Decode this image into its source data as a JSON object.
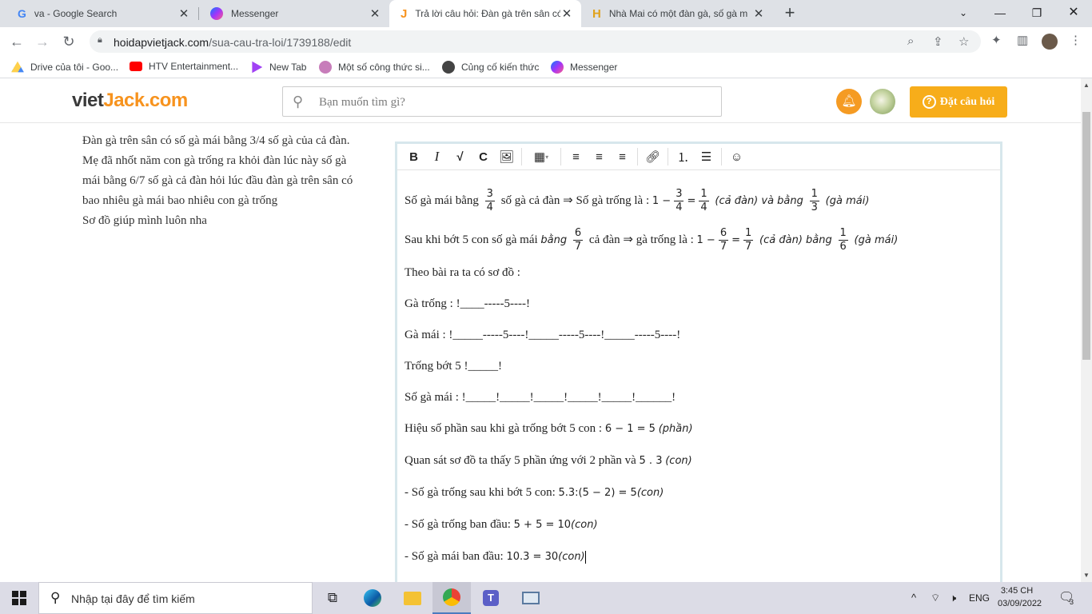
{
  "browser": {
    "tabs": [
      {
        "title": "va - Google Search",
        "icon": "google-icon"
      },
      {
        "title": "Messenger",
        "icon": "messenger-icon"
      },
      {
        "title": "Trả lời câu hỏi: Đàn gà trên sân có",
        "icon": "vietjack-icon"
      },
      {
        "title": "Nhà Mai có một đàn gà, số gà m",
        "icon": "hoidap-icon"
      }
    ],
    "url_domain": "hoidapvietjack.com",
    "url_path": "/sua-cau-tra-loi/1739188/edit",
    "bookmarks": [
      {
        "label": "Drive của tôi - Goo...",
        "icon": "drive-icon",
        "color": "#1fa463"
      },
      {
        "label": "HTV Entertainment...",
        "icon": "youtube-icon",
        "color": "#ff0000"
      },
      {
        "label": "New Tab",
        "icon": "newtab-icon",
        "color": "#a142f4"
      },
      {
        "label": "Một số công thức si...",
        "icon": "app-icon",
        "color": "#c77dba"
      },
      {
        "label": "Củng cố kiến thức",
        "icon": "app-icon",
        "color": "#444444"
      },
      {
        "label": "Messenger",
        "icon": "messenger-icon",
        "color": "#a33ae8"
      }
    ]
  },
  "site": {
    "logo_a": "viet",
    "logo_b": "Jack",
    "logo_c": ".com",
    "search_placeholder": "Bạn muốn tìm gì?",
    "ask_button": "Đặt câu hỏi",
    "accent": "#f7ad1a"
  },
  "question": {
    "text": "Đàn gà trên sân có số gà mái bằng 3/4 số gà của cả đàn. Mẹ đã nhốt năm con gà trống ra khỏi đàn lúc này số gà mái bằng 6/7 số gà cả đàn hỏi lúc đầu đàn gà trên sân có bao nhiêu gà mái bao nhiêu con gà trống",
    "note": "Sơ đồ giúp mình luôn nha"
  },
  "answer": {
    "l1a": "Số gà mái bằng",
    "l1b": "số gà cả đàn ⇒ Số gà trống là :",
    "l1c": "(cả đàn) và bằng",
    "l1d": "(gà mái)",
    "l2a": "Sau khi bớt 5 con số gà mái",
    "l2b": "bằng",
    "l2c": "cả đàn ⇒ gà trống là :",
    "l2d": "(cả đàn) bằng",
    "l2e": "(gà mái)",
    "l3": "Theo bài ra ta có sơ đồ :",
    "l4": "Gà trống :   !____-----5----!",
    "l5": "Gà mái :      !_____-----5----!_____-----5----!_____-----5----!",
    "l6": "Trống bớt 5 !_____!",
    "l7": "Số gà mái :  !_____!_____!_____!_____!_____!______!",
    "l8a": "Hiệu số phần sau khi gà trống bớt 5 con :",
    "l8b": "6 − 1  =  5",
    "l8c": "(phần)",
    "l9a": "Quan sát sơ đồ ta thấy 5 phần ứng với 2 phần và",
    "l9b": "5 . 3",
    "l9c": "(con)",
    "l10a": "- Số gà trống sau khi bớt 5 con:",
    "l10b": "5.3:(5 − 2) = 5",
    "l10c": "(con)",
    "l11a": "- Số gà trống ban đầu:",
    "l11b": "5 + 5 = 10",
    "l11c": "(con)",
    "l12a": "- Số gà mái ban đầu:",
    "l12b": "10.3 = 30",
    "l12c": "(con)"
  },
  "taskbar": {
    "search_placeholder": "Nhập tại đây để tìm kiếm",
    "lang": "ENG",
    "time": "3:45 CH",
    "date": "03/09/2022",
    "notifications": "3"
  }
}
